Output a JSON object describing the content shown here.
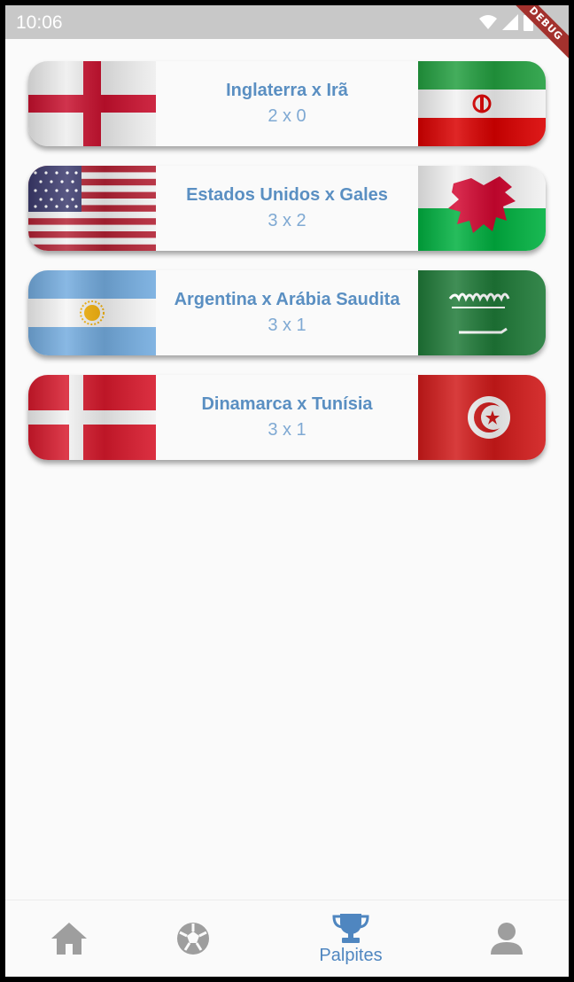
{
  "status": {
    "time": "10:06",
    "debug_label": "DEBUG"
  },
  "matches": [
    {
      "title": "Inglaterra x Irã",
      "score": "2 x 0",
      "home_flag": "england-flag",
      "away_flag": "iran-flag"
    },
    {
      "title": "Estados Unidos x Gales",
      "score": "3 x 2",
      "home_flag": "usa-flag",
      "away_flag": "wales-flag"
    },
    {
      "title": "Argentina x Arábia Saudita",
      "score": "3 x 1",
      "home_flag": "argentina-flag",
      "away_flag": "saudi-arabia-flag"
    },
    {
      "title": "Dinamarca x Tunísia",
      "score": "3 x 1",
      "home_flag": "denmark-flag",
      "away_flag": "tunisia-flag"
    }
  ],
  "nav": {
    "items": [
      {
        "icon": "home-icon",
        "label": ""
      },
      {
        "icon": "soccer-ball-icon",
        "label": ""
      },
      {
        "icon": "trophy-icon",
        "label": "Palpites"
      },
      {
        "icon": "person-icon",
        "label": ""
      }
    ],
    "active_index": 2
  },
  "colors": {
    "accent": "#4f86c0",
    "inactive": "#9e9e9e",
    "title": "#5a8fc2",
    "score": "#7fa9d3"
  }
}
